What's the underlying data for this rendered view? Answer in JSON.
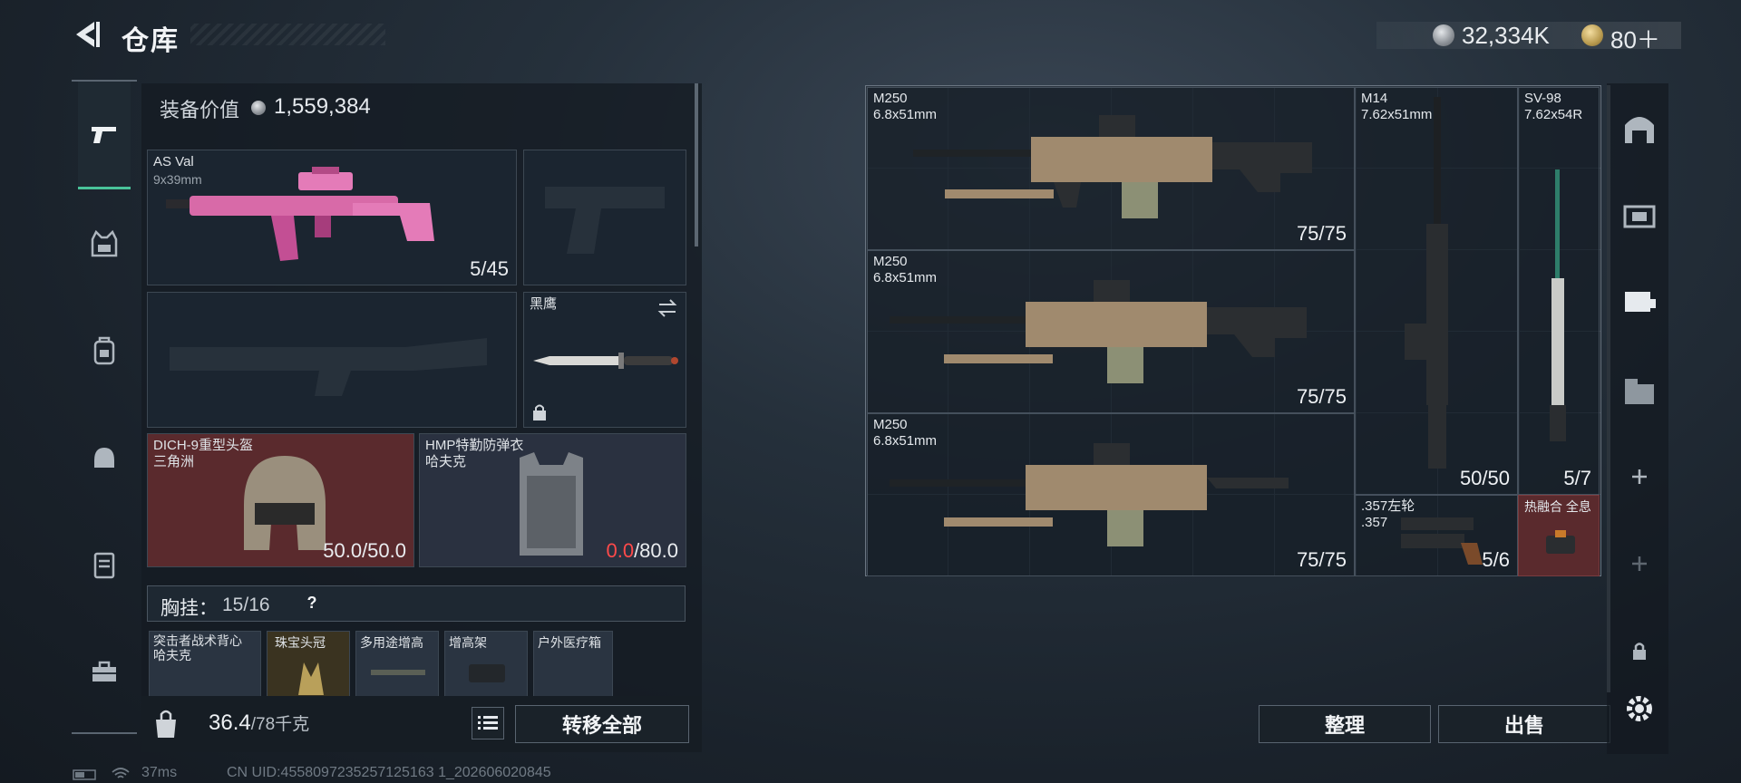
{
  "header": {
    "title": "仓库",
    "currency_silver": "32,334K",
    "currency_gold": "80＋"
  },
  "equipment": {
    "value_label": "装备价值",
    "value": "1,559,384",
    "primary": {
      "name": "AS Val",
      "caliber": "9x39mm",
      "count": "5/45"
    },
    "knife": {
      "name": "黑鹰"
    },
    "helmet": {
      "name": "DICH-9重型头盔",
      "faction": "三角洲",
      "durability_current": "50.0",
      "durability_max": "/50.0"
    },
    "armor": {
      "name": "HMP特勤防弹衣",
      "faction": "哈夫克",
      "durability_current": "0.0",
      "durability_max": "/80.0"
    },
    "vest": {
      "label": "胸挂：",
      "capacity": "15/16",
      "help": "?"
    },
    "vest_items": [
      {
        "name": "突击者战术背心",
        "sub": "哈夫克"
      },
      {
        "name": "珠宝头冠",
        "sub": ""
      },
      {
        "name": "多用途增高",
        "sub": ""
      },
      {
        "name": "增高架",
        "sub": ""
      },
      {
        "name": "户外医疗箱",
        "sub": ""
      }
    ],
    "weight": "36.4",
    "weight_max": "/78千克",
    "transfer_all": "转移全部"
  },
  "stash": {
    "items": [
      {
        "name": "M250",
        "caliber": "6.8x51mm",
        "count": "75/75"
      },
      {
        "name": "M250",
        "caliber": "6.8x51mm",
        "count": "75/75"
      },
      {
        "name": "M250",
        "caliber": "6.8x51mm",
        "count": "75/75"
      },
      {
        "name": "M14",
        "caliber": "7.62x51mm",
        "count": "50/50"
      },
      {
        "name": "SV-98",
        "caliber": "7.62x54R",
        "count": "5/7"
      },
      {
        "name": ".357左轮",
        "caliber": ".357",
        "count": "5/6"
      },
      {
        "name": "热融合 全息",
        "caliber": "",
        "count": ""
      }
    ],
    "sort_button": "整理",
    "sell_button": "出售"
  },
  "status": {
    "ping": "37ms",
    "uid": "CN UID:4558097235257125163 1_202606020845"
  },
  "colors": {
    "accent_green": "#49c39a",
    "broken_red": "#ff4a4a",
    "hot_item_bg": "#5a2a2d"
  },
  "icons": [
    "back-arrow-icon",
    "silver-coin-icon",
    "gold-coin-icon",
    "pistol-icon",
    "vest-icon",
    "backpack-icon",
    "helmet-bag-icon",
    "locker-icon",
    "toolbox-icon",
    "swap-icon",
    "lock-icon",
    "list-icon",
    "bag-weight-icon",
    "gear-icon"
  ]
}
